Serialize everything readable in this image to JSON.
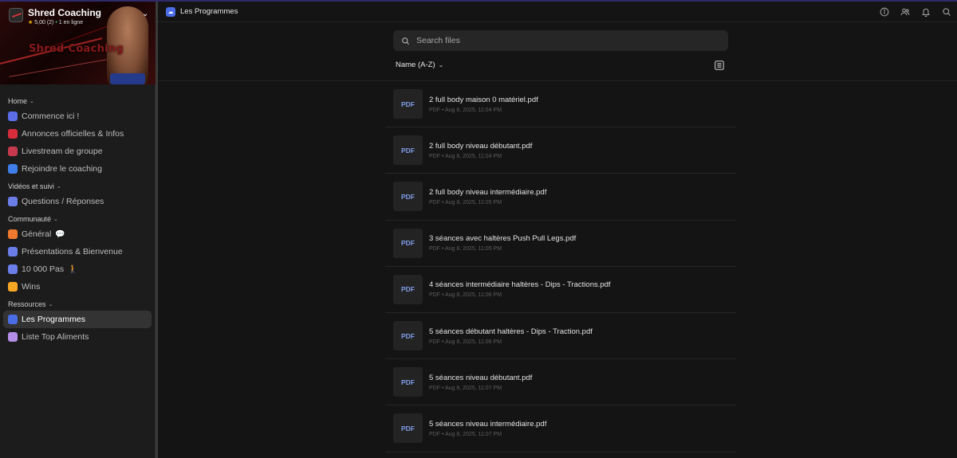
{
  "community": {
    "name": "Shred Coaching",
    "rating": "5,00",
    "reviews": "(2)",
    "online": "1 en ligne",
    "banner_text": "Shred Coaching"
  },
  "sidebar": {
    "sections": [
      {
        "title": "Home",
        "items": [
          {
            "label": "Commence ici !",
            "icon": "graduation-cap-icon",
            "color": "#5b6ee8"
          },
          {
            "label": "Annonces officielles & Infos",
            "icon": "red-square-icon",
            "color": "#d62c3b"
          },
          {
            "label": "Livestream de groupe",
            "icon": "red-dot-icon",
            "color": "#c53a4d"
          },
          {
            "label": "Rejoindre le coaching",
            "icon": "arrow-pointer-icon",
            "color": "#3f7de8"
          }
        ]
      },
      {
        "title": "Vidéos et suivi",
        "items": [
          {
            "label": "Questions / Réponses",
            "icon": "chart-icon",
            "color": "#6b7ee8"
          }
        ]
      },
      {
        "title": "Communauté",
        "items": [
          {
            "label": "Général",
            "emoji": "💬",
            "icon": "orange-square-icon",
            "color": "#f07a2f"
          },
          {
            "label": "Présentations & Bienvenue",
            "icon": "chart-icon",
            "color": "#6b7ee8"
          },
          {
            "label": "10 000 Pas",
            "emoji": "🚶",
            "icon": "chart-icon",
            "color": "#6b7ee8"
          },
          {
            "label": "Wins",
            "icon": "orange-square-icon",
            "color": "#f5a623"
          }
        ]
      },
      {
        "title": "Ressources",
        "items": [
          {
            "label": "Les Programmes",
            "icon": "cloud-icon",
            "color": "#4a6de6",
            "active": true
          },
          {
            "label": "Liste Top Aliments",
            "icon": "list-icon",
            "color": "#b58ee8"
          }
        ]
      }
    ]
  },
  "header": {
    "title": "Les Programmes"
  },
  "search": {
    "placeholder": "Search files"
  },
  "sort": {
    "label": "Name (A-Z)"
  },
  "files": [
    {
      "name": "2 full body maison 0 matériel.pdf",
      "meta": "PDF • Aug 8, 2025, 11:04 PM",
      "badge": "PDF"
    },
    {
      "name": "2 full body niveau débutant.pdf",
      "meta": "PDF • Aug 8, 2025, 11:04 PM",
      "badge": "PDF"
    },
    {
      "name": "2 full body niveau intermédiaire.pdf",
      "meta": "PDF • Aug 8, 2025, 11:05 PM",
      "badge": "PDF"
    },
    {
      "name": "3 séances avec haltères Push Pull Legs.pdf",
      "meta": "PDF • Aug 8, 2025, 11:05 PM",
      "badge": "PDF"
    },
    {
      "name": "4 séances intermédiaire haltères - Dips - Tractions.pdf",
      "meta": "PDF • Aug 8, 2025, 11:06 PM",
      "badge": "PDF"
    },
    {
      "name": "5 séances débutant haltères - Dips - Traction.pdf",
      "meta": "PDF • Aug 8, 2025, 11:06 PM",
      "badge": "PDF"
    },
    {
      "name": "5 séances niveau débutant.pdf",
      "meta": "PDF • Aug 8, 2025, 11:07 PM",
      "badge": "PDF"
    },
    {
      "name": "5 séances niveau intermédiaire.pdf",
      "meta": "PDF • Aug 8, 2025, 11:07 PM",
      "badge": "PDF"
    }
  ]
}
